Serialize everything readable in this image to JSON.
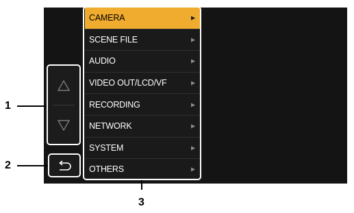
{
  "menu": {
    "items": [
      {
        "label": "CAMERA",
        "selected": true
      },
      {
        "label": "SCENE FILE",
        "selected": false
      },
      {
        "label": "AUDIO",
        "selected": false
      },
      {
        "label": "VIDEO OUT/LCD/VF",
        "selected": false
      },
      {
        "label": "RECORDING",
        "selected": false
      },
      {
        "label": "NETWORK",
        "selected": false
      },
      {
        "label": "SYSTEM",
        "selected": false
      },
      {
        "label": "OTHERS",
        "selected": false
      }
    ],
    "submenu_arrow_icon": "triangle-right-icon"
  },
  "controls": {
    "scroll_up_icon": "triangle-up-outline-icon",
    "scroll_down_icon": "triangle-down-outline-icon",
    "back_icon": "return-arrow-icon"
  },
  "callouts": {
    "label_1": "1",
    "label_2": "2",
    "label_3": "3"
  },
  "colors": {
    "background": "#141414",
    "highlight": "#f0ac2e",
    "callout_frame": "#ffffff"
  }
}
